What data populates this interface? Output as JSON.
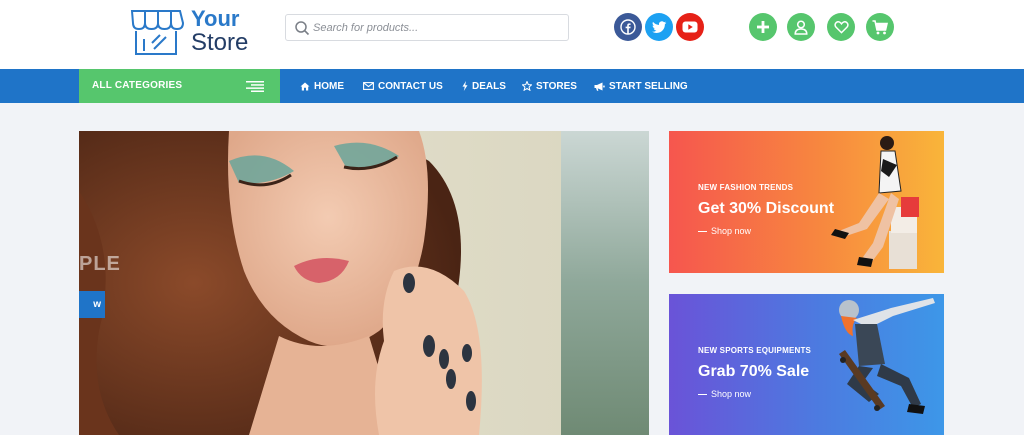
{
  "brand": {
    "line1": "Your",
    "line2": "Store",
    "blue": "#2a79c9",
    "navy": "#233d66"
  },
  "search": {
    "placeholder": "Search for products..."
  },
  "social": [
    {
      "icon": "facebook-icon",
      "color": "#3b5998"
    },
    {
      "icon": "twitter-icon",
      "color": "#1da1f2"
    },
    {
      "icon": "youtube-icon",
      "color": "#e62117"
    }
  ],
  "user_actions": [
    {
      "icon": "plus-icon",
      "color": "#56c66d"
    },
    {
      "icon": "user-icon",
      "color": "#56c66d"
    },
    {
      "icon": "heart-icon",
      "color": "#56c66d"
    },
    {
      "icon": "cart-icon",
      "color": "#56c66d"
    }
  ],
  "nav": {
    "categories_label": "ALL CATEGORIES",
    "items": [
      {
        "label": "HOME",
        "icon": "home-icon"
      },
      {
        "label": "CONTACT US",
        "icon": "envelope-icon"
      },
      {
        "label": "DEALS",
        "icon": "bolt-icon"
      },
      {
        "label": "STORES",
        "icon": "star-icon"
      },
      {
        "label": "START SELLING",
        "icon": "megaphone-icon"
      }
    ],
    "bar_color": "#1f74c8",
    "categories_color": "#56c66d"
  },
  "hero": {
    "partial_text": "PLE",
    "button_text": "w"
  },
  "banners": [
    {
      "kicker": "NEW FASHION TRENDS",
      "headline": "Get 30% Discount",
      "cta": "Shop now"
    },
    {
      "kicker": "NEW SPORTS EQUIPMENTS",
      "headline": "Grab 70% Sale",
      "cta": "Shop now"
    }
  ]
}
